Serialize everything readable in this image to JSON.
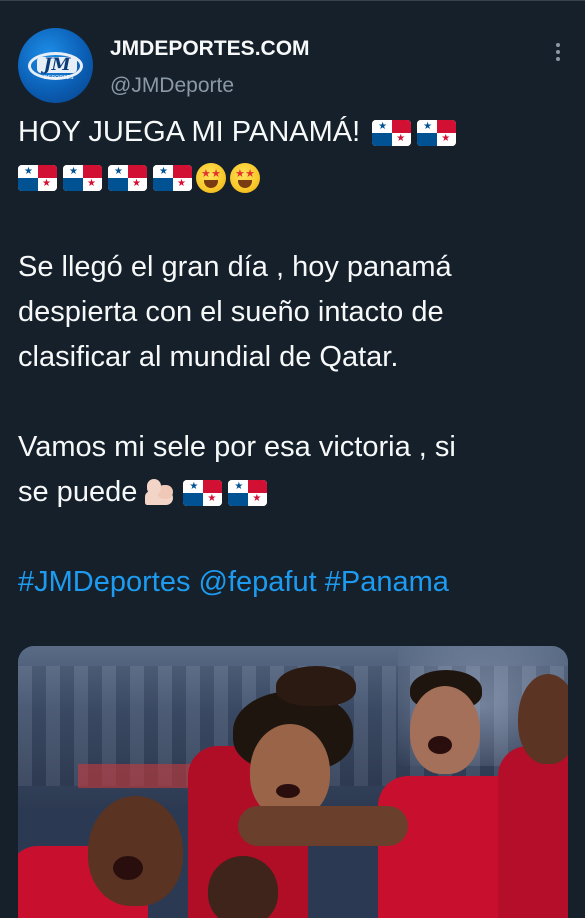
{
  "tweet": {
    "author": {
      "display_name": "JMDEPORTES.COM",
      "handle": "@JMDeporte",
      "avatar_logo_text": "JM",
      "avatar_logo_subtext": "DEPORTES"
    },
    "text_lines": {
      "line1": "HOY JUEGA MI PANAMÁ!",
      "p2_line1": "Se llegó el gran día , hoy panamá",
      "p2_line2": "despierta con el sueño intacto de",
      "p2_line3": "clasificar al mundial de Qatar.",
      "p3_line1": "Vamos mi sele por esa victoria , si",
      "p3_line2": "se puede"
    },
    "hashtags": {
      "tag1": "#JMDeportes",
      "mention": "@fepafut",
      "tag2": "#Panama"
    },
    "emoji": {
      "flag": "panama-flag",
      "star_face": "star-struck-face",
      "arm": "flexed-biceps"
    },
    "media": {
      "type": "photo",
      "description_icon": "celebrating-players-photo"
    }
  },
  "colors": {
    "background": "#15202b",
    "text": "#f7f9f9",
    "secondary_text": "#8b98a5",
    "link": "#1d9bf0",
    "flag_red": "#d21034",
    "flag_blue": "#005293"
  }
}
